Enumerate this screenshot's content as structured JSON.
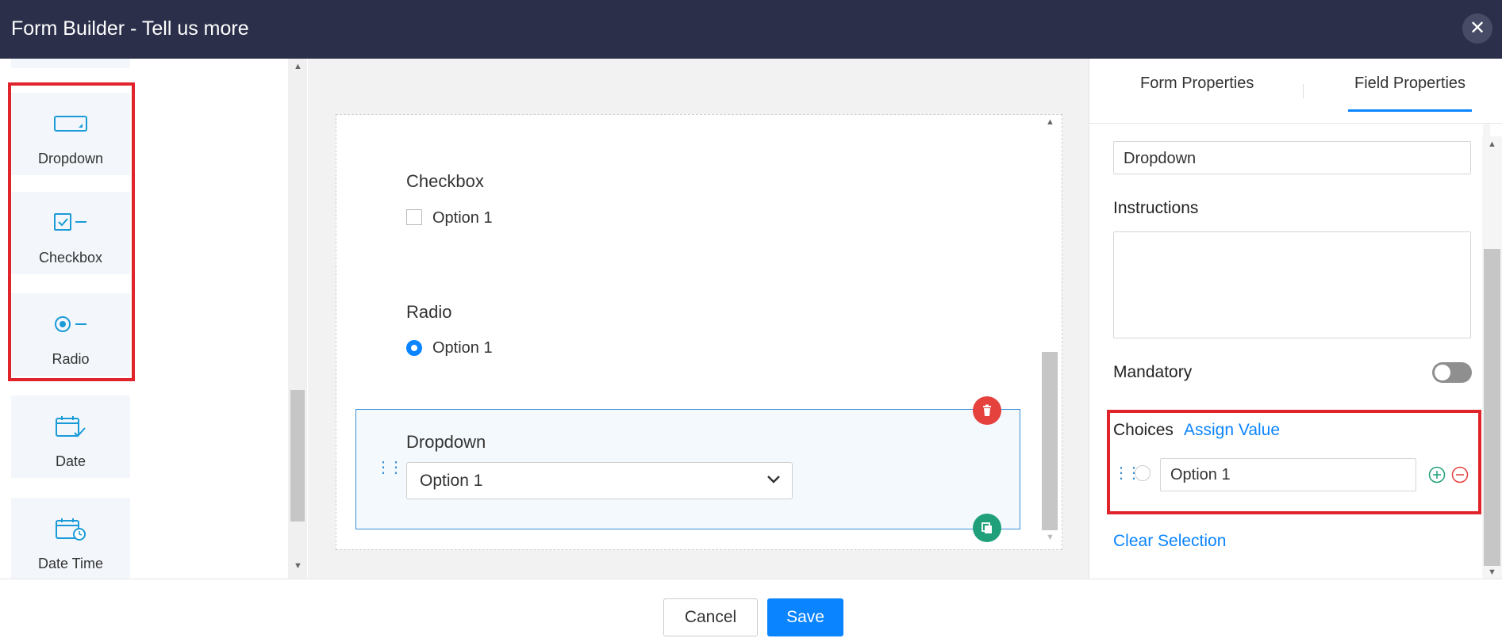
{
  "header": {
    "title": "Form Builder - Tell us more",
    "close_icon": "close-icon"
  },
  "palette": {
    "items": [
      {
        "label": "Dropdown",
        "icon": "dropdown-icon"
      },
      {
        "label": "Checkbox",
        "icon": "checkbox-icon"
      },
      {
        "label": "Radio",
        "icon": "radio-icon"
      },
      {
        "label": "Date",
        "icon": "date-icon"
      },
      {
        "label": "Date Time",
        "icon": "date-time-icon"
      }
    ]
  },
  "form": {
    "checkbox": {
      "label": "Checkbox",
      "option": "Option 1"
    },
    "radio": {
      "label": "Radio",
      "option": "Option 1"
    },
    "dropdown": {
      "label": "Dropdown",
      "value": "Option 1"
    }
  },
  "properties": {
    "tabs": [
      "Form Properties",
      "Field Properties"
    ],
    "active_tab": "Field Properties",
    "field_label_value": "Dropdown",
    "instructions_label": "Instructions",
    "mandatory_label": "Mandatory",
    "mandatory_on": false,
    "choices_label": "Choices",
    "assign_value_label": "Assign Value",
    "choice_value": "Option 1",
    "clear_selection_label": "Clear Selection"
  },
  "footer": {
    "cancel_label": "Cancel",
    "save_label": "Save"
  },
  "colors": {
    "header_bg": "#2b2f4a",
    "accent": "#0a84ff",
    "highlight": "#e0242b",
    "delete": "#e5413d",
    "copy": "#1fa07a"
  }
}
